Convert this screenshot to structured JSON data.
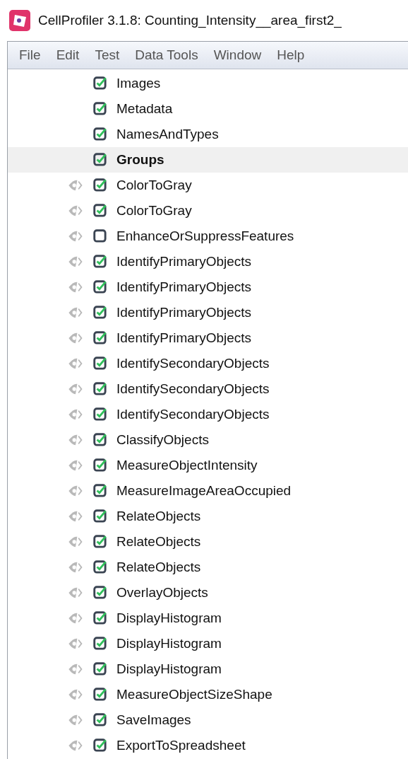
{
  "window": {
    "title": "CellProfiler 3.1.8: Counting_Intensity__area_first2_"
  },
  "menu": [
    "File",
    "Edit",
    "Test",
    "Data Tools",
    "Window",
    "Help"
  ],
  "modules": [
    {
      "name": "Images",
      "kind": "input",
      "enabled": true,
      "selected": false
    },
    {
      "name": "Metadata",
      "kind": "input",
      "enabled": true,
      "selected": false
    },
    {
      "name": "NamesAndTypes",
      "kind": "input",
      "enabled": true,
      "selected": false
    },
    {
      "name": "Groups",
      "kind": "input",
      "enabled": true,
      "selected": true
    },
    {
      "name": "ColorToGray",
      "kind": "module",
      "enabled": true,
      "selected": false
    },
    {
      "name": "ColorToGray",
      "kind": "module",
      "enabled": true,
      "selected": false
    },
    {
      "name": "EnhanceOrSuppressFeatures",
      "kind": "module",
      "enabled": false,
      "selected": false
    },
    {
      "name": "IdentifyPrimaryObjects",
      "kind": "module",
      "enabled": true,
      "selected": false
    },
    {
      "name": "IdentifyPrimaryObjects",
      "kind": "module",
      "enabled": true,
      "selected": false
    },
    {
      "name": "IdentifyPrimaryObjects",
      "kind": "module",
      "enabled": true,
      "selected": false
    },
    {
      "name": "IdentifyPrimaryObjects",
      "kind": "module",
      "enabled": true,
      "selected": false
    },
    {
      "name": "IdentifySecondaryObjects",
      "kind": "module",
      "enabled": true,
      "selected": false
    },
    {
      "name": "IdentifySecondaryObjects",
      "kind": "module",
      "enabled": true,
      "selected": false
    },
    {
      "name": "IdentifySecondaryObjects",
      "kind": "module",
      "enabled": true,
      "selected": false
    },
    {
      "name": "ClassifyObjects",
      "kind": "module",
      "enabled": true,
      "selected": false
    },
    {
      "name": "MeasureObjectIntensity",
      "kind": "module",
      "enabled": true,
      "selected": false
    },
    {
      "name": "MeasureImageAreaOccupied",
      "kind": "module",
      "enabled": true,
      "selected": false
    },
    {
      "name": "RelateObjects",
      "kind": "module",
      "enabled": true,
      "selected": false
    },
    {
      "name": "RelateObjects",
      "kind": "module",
      "enabled": true,
      "selected": false
    },
    {
      "name": "RelateObjects",
      "kind": "module",
      "enabled": true,
      "selected": false
    },
    {
      "name": "OverlayObjects",
      "kind": "module",
      "enabled": true,
      "selected": false
    },
    {
      "name": "DisplayHistogram",
      "kind": "module",
      "enabled": true,
      "selected": false
    },
    {
      "name": "DisplayHistogram",
      "kind": "module",
      "enabled": true,
      "selected": false
    },
    {
      "name": "DisplayHistogram",
      "kind": "module",
      "enabled": true,
      "selected": false
    },
    {
      "name": "MeasureObjectSizeShape",
      "kind": "module",
      "enabled": true,
      "selected": false
    },
    {
      "name": "SaveImages",
      "kind": "module",
      "enabled": true,
      "selected": false
    },
    {
      "name": "ExportToSpreadsheet",
      "kind": "module",
      "enabled": true,
      "selected": false
    }
  ]
}
